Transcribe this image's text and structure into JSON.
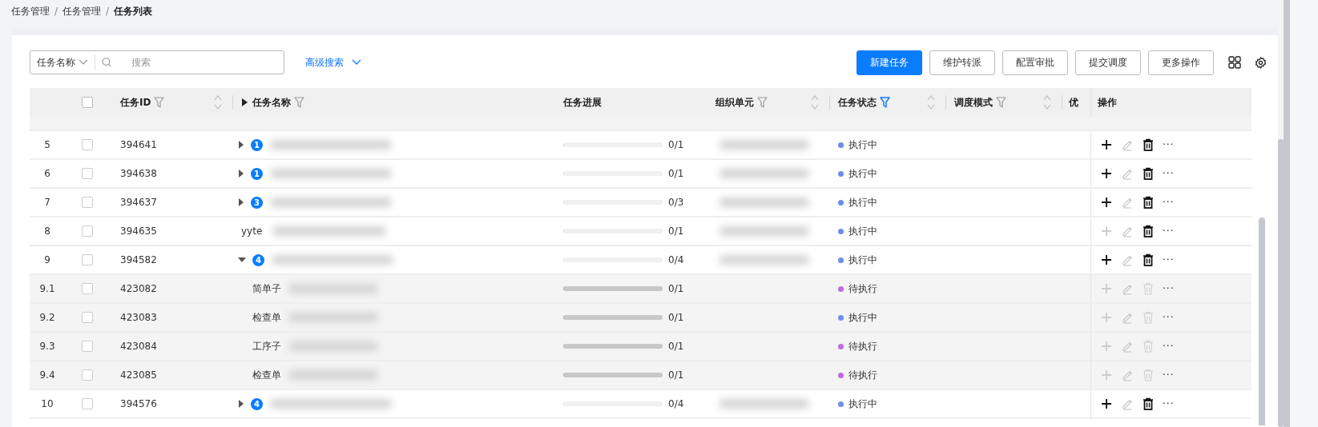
{
  "breadcrumb": [
    {
      "label": "任务管理",
      "current": false
    },
    {
      "label": "任务管理",
      "current": false
    },
    {
      "label": "任务列表",
      "current": true
    }
  ],
  "breadcrumb_separator": "/",
  "search": {
    "field_select": "任务名称",
    "placeholder": "搜索",
    "advanced": "高级搜索"
  },
  "buttons": [
    {
      "label": "新建任务",
      "primary": true
    },
    {
      "label": "维护转派",
      "primary": false
    },
    {
      "label": "配置审批",
      "primary": false
    },
    {
      "label": "提交调度",
      "primary": false
    },
    {
      "label": "更多操作",
      "primary": false
    }
  ],
  "table": {
    "select_all_checked": false,
    "columns": [
      {
        "label": "任务ID",
        "kind": "sortable",
        "filter_active": false
      },
      {
        "label": "任务名称",
        "kind": "name",
        "filter_active": false
      },
      {
        "label": "任务进展",
        "kind": "plain"
      },
      {
        "label": "组织单元",
        "kind": "sortable",
        "filter_active": false
      },
      {
        "label": "任务状态",
        "kind": "sortable",
        "filter_active": true
      },
      {
        "label": "调度模式",
        "kind": "sortable",
        "filter_active": false
      },
      {
        "label": "优",
        "kind": "cut"
      },
      {
        "label": "操作",
        "kind": "plain"
      }
    ],
    "rows": [
      {
        "kind": "parent",
        "index": "5",
        "checked": false,
        "id": "394641",
        "expanded": false,
        "count": "1",
        "progress": "0/1",
        "level": 0,
        "status": "执行中",
        "color": "#6b8ef0",
        "add_enabled": true,
        "delete_enabled": true,
        "more": "···"
      },
      {
        "kind": "parent",
        "index": "6",
        "checked": false,
        "id": "394638",
        "expanded": false,
        "count": "1",
        "progress": "0/1",
        "level": 0,
        "status": "执行中",
        "color": "#6b8ef0",
        "add_enabled": true,
        "delete_enabled": true,
        "more": "···"
      },
      {
        "kind": "parent",
        "index": "7",
        "checked": false,
        "id": "394637",
        "expanded": false,
        "count": "3",
        "progress": "0/3",
        "level": 0,
        "status": "执行中",
        "color": "#6b8ef0",
        "add_enabled": true,
        "delete_enabled": true,
        "more": "···"
      },
      {
        "kind": "leaf",
        "index": "8",
        "checked": false,
        "id": "394635",
        "name": "yyte",
        "progress": "0/1",
        "level": 0,
        "status": "执行中",
        "color": "#6b8ef0",
        "add_enabled": false,
        "delete_enabled": true,
        "more": "···"
      },
      {
        "kind": "parent",
        "index": "9",
        "checked": false,
        "id": "394582",
        "expanded": true,
        "count": "4",
        "progress": "0/4",
        "level": 0,
        "status": "执行中",
        "color": "#6b8ef0",
        "add_enabled": true,
        "delete_enabled": true,
        "more": "···"
      },
      {
        "kind": "child",
        "index": "9.1",
        "checked": false,
        "id": "423082",
        "name": "简单子",
        "progress": "0/1",
        "level": 0,
        "status": "待执行",
        "color": "#c06ae8",
        "add_enabled": false,
        "delete_enabled": false,
        "more": "···"
      },
      {
        "kind": "child",
        "index": "9.2",
        "checked": false,
        "id": "423083",
        "name": "检查单",
        "progress": "0/1",
        "level": 0,
        "status": "执行中",
        "color": "#6b8ef0",
        "add_enabled": false,
        "delete_enabled": false,
        "more": "···"
      },
      {
        "kind": "child",
        "index": "9.3",
        "checked": false,
        "id": "423084",
        "name": "工序子",
        "progress": "0/1",
        "level": 0,
        "status": "待执行",
        "color": "#c06ae8",
        "add_enabled": false,
        "delete_enabled": false,
        "more": "···"
      },
      {
        "kind": "child",
        "index": "9.4",
        "checked": false,
        "id": "423085",
        "name": "检查单",
        "progress": "0/1",
        "level": 0,
        "status": "待执行",
        "color": "#c06ae8",
        "add_enabled": false,
        "delete_enabled": false,
        "more": "···"
      },
      {
        "kind": "parent",
        "index": "10",
        "checked": false,
        "id": "394576",
        "expanded": false,
        "count": "4",
        "progress": "0/4",
        "level": 0,
        "status": "执行中",
        "color": "#6b8ef0",
        "add_enabled": true,
        "delete_enabled": true,
        "more": "···"
      }
    ]
  }
}
